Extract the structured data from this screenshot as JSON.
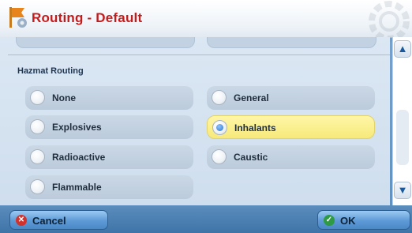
{
  "window": {
    "title": "Routing - Default"
  },
  "section": {
    "label": "Hazmat Routing"
  },
  "options": [
    {
      "label": "None",
      "selected": false
    },
    {
      "label": "General",
      "selected": false
    },
    {
      "label": "Explosives",
      "selected": false
    },
    {
      "label": "Inhalants",
      "selected": true
    },
    {
      "label": "Radioactive",
      "selected": false
    },
    {
      "label": "Caustic",
      "selected": false
    },
    {
      "label": "Flammable",
      "selected": false
    }
  ],
  "footer": {
    "cancel_label": "Cancel",
    "ok_label": "OK"
  },
  "colors": {
    "title": "#c21d1d",
    "selected": "#f7e97a",
    "accent": "#2a74c9"
  },
  "icons": {
    "app": "routing-flag-icon",
    "background": "gear-icon",
    "scroll_up": "chevron-up-icon",
    "scroll_down": "chevron-down-icon",
    "cancel": "cancel-icon",
    "ok": "check-icon"
  }
}
